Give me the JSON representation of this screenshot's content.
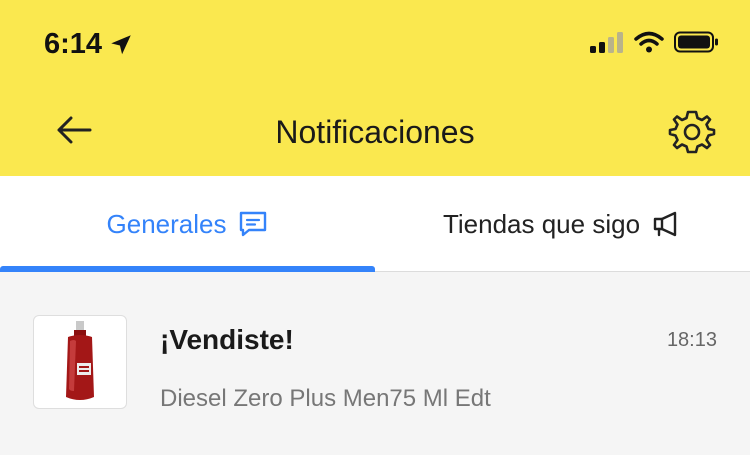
{
  "status_bar": {
    "time": "6:14"
  },
  "nav": {
    "title": "Notificaciones"
  },
  "tabs": [
    {
      "label": "Generales",
      "active": true,
      "icon": "chat-bubble-icon"
    },
    {
      "label": "Tiendas que sigo",
      "active": false,
      "icon": "megaphone-icon"
    }
  ],
  "notifications": [
    {
      "title": "¡Vendiste!",
      "time": "18:13",
      "description": "Diesel Zero Plus Men75 Ml Edt",
      "thumbnail": "perfume-bottle"
    }
  ],
  "colors": {
    "header_bg": "#fae84f",
    "accent": "#3483fa",
    "content_bg": "#f5f5f5"
  }
}
